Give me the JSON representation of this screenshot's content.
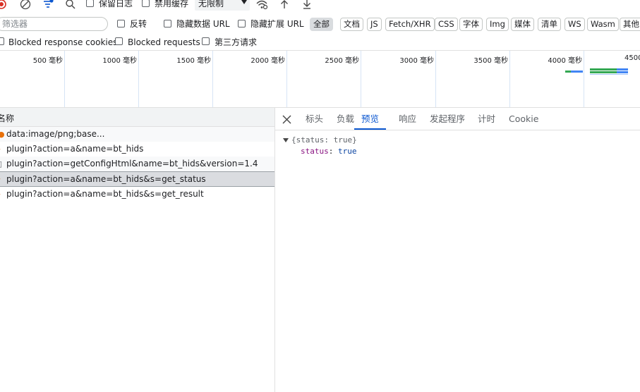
{
  "toolbar": {
    "preserve_log_label": "保留日志",
    "disable_cache_label": "禁用缓存",
    "throttle_value": "无限制",
    "icons": [
      "record-stop-icon",
      "clear-icon",
      "filter-icon",
      "search-icon",
      "network-conditions-icon",
      "import-icon",
      "export-icon"
    ]
  },
  "filter": {
    "placeholder": "筛选器",
    "invert_label": "反转",
    "hide_data_urls_label": "隐藏数据 URL",
    "hide_extension_urls_label": "隐藏扩展 URL",
    "type_chips": [
      "全部",
      "文档",
      "JS",
      "Fetch/XHR",
      "CSS",
      "字体",
      "Img",
      "媒体",
      "清单",
      "WS",
      "Wasm",
      "其他"
    ],
    "active_chip": "全部"
  },
  "blocked": {
    "blocked_cookies_label": "Blocked response cookies",
    "blocked_requests_label": "Blocked requests",
    "third_party_label": "第三方请求"
  },
  "timeline": {
    "ticks": [
      "500 毫秒",
      "1000 毫秒",
      "1500 毫秒",
      "2000 毫秒",
      "2500 毫秒",
      "3000 毫秒",
      "3500 毫秒",
      "4000 毫秒",
      "4500"
    ],
    "colors": {
      "grid": "#d6e4f5",
      "waiting": "#34a853",
      "download": "#4285f4"
    }
  },
  "requests": {
    "column_name": "名称",
    "rows": [
      {
        "name": "data:image/png;base...",
        "icon": "image-request-icon"
      },
      {
        "name": "plugin?action=a&name=bt_hids",
        "icon": "xhr-request-icon"
      },
      {
        "name": "plugin?action=getConfigHtml&name=bt_hids&version=1.4",
        "icon": "document-request-icon"
      },
      {
        "name": "plugin?action=a&name=bt_hids&s=get_status",
        "icon": "xhr-request-icon"
      },
      {
        "name": "plugin?action=a&name=bt_hids&s=get_result",
        "icon": "xhr-request-icon"
      }
    ],
    "selected_index": 3
  },
  "details": {
    "tabs": [
      "标头",
      "负载",
      "预览",
      "响应",
      "发起程序",
      "计时",
      "Cookie"
    ],
    "active_tab": "预览",
    "preview": {
      "summary": "{status: true}",
      "key": "status",
      "value": "true"
    }
  }
}
